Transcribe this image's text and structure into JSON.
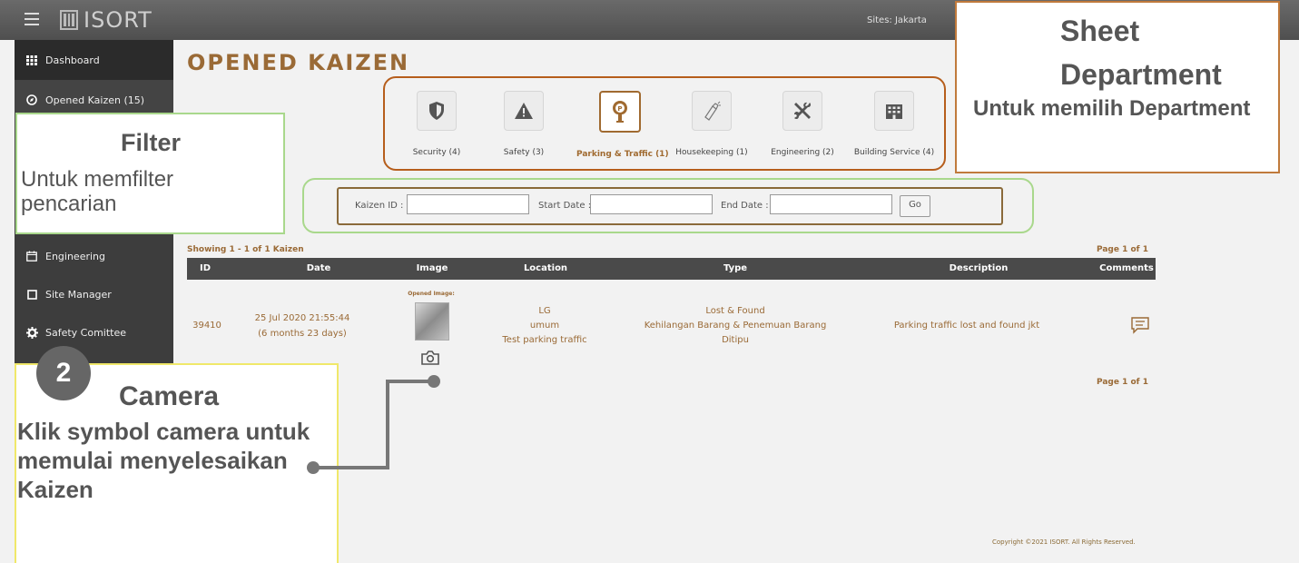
{
  "app": {
    "logo_text": "ISORT",
    "sites_label": "Sites: Jakarta"
  },
  "sidebar": {
    "items": [
      {
        "label": "Dashboard",
        "icon": "grid-icon"
      },
      {
        "label": "Opened Kaizen (15)",
        "icon": "compass-icon"
      },
      {
        "label": "Engineering",
        "icon": "calendar-icon"
      },
      {
        "label": "Site Manager",
        "icon": "square-icon"
      },
      {
        "label": "Safety Comittee",
        "icon": "gear-icon"
      }
    ]
  },
  "main": {
    "title": "OPENED KAIZEN",
    "departments": [
      {
        "label": "Security (4)",
        "icon": "shield-icon",
        "active": false
      },
      {
        "label": "Safety (3)",
        "icon": "warning-icon",
        "active": false
      },
      {
        "label": "Parking & Traffic (1)",
        "icon": "parking-meter-icon",
        "active": true
      },
      {
        "label": "Housekeeping (1)",
        "icon": "spray-bottle-icon",
        "active": false
      },
      {
        "label": "Engineering (2)",
        "icon": "tools-icon",
        "active": false
      },
      {
        "label": "Building Service (4)",
        "icon": "building-icon",
        "active": false
      }
    ],
    "filter": {
      "kaizen_id_label": "Kaizen ID :",
      "start_date_label": "Start Date :",
      "end_date_label": "End Date :",
      "kaizen_id_value": "",
      "start_date_value": "",
      "end_date_value": "",
      "go_label": "Go"
    },
    "showing": "Showing 1 - 1 of 1 Kaizen",
    "page_top": "Page 1 of 1",
    "page_bottom": "Page 1 of 1",
    "table": {
      "headers": [
        "ID",
        "Date",
        "Image",
        "Location",
        "Type",
        "Description",
        "Comments"
      ],
      "rows": [
        {
          "id": "39410",
          "date": "25 Jul 2020 21:55:44",
          "age": "(6 months 23 days)",
          "image_label": "Opened Image:",
          "location": [
            "LG",
            "umum",
            "Test parking traffic"
          ],
          "type": [
            "Lost & Found",
            "Kehilangan Barang & Penemuan Barang",
            "Ditipu"
          ],
          "description": "Parking traffic lost and found jkt"
        }
      ]
    },
    "copyright": "Copyright ©2021 ISORT. All Rights Reserved."
  },
  "callouts": {
    "filter": {
      "title": "Filter",
      "desc": "Untuk memfilter pencarian",
      "color": "#a9d88c"
    },
    "department": {
      "title_1": "Sheet",
      "title_2": "Department",
      "desc": "Untuk memilih Department",
      "color": "#c07a3c"
    },
    "camera": {
      "number": "2",
      "title": "Camera",
      "desc": "Klik symbol camera untuk memulai menyelesaikan Kaizen",
      "color": "#f0e86a"
    }
  },
  "colors": {
    "accent": "#9a6a36",
    "sidebar_bg": "#3d3d3d",
    "table_header_bg": "#4a4a4a"
  }
}
